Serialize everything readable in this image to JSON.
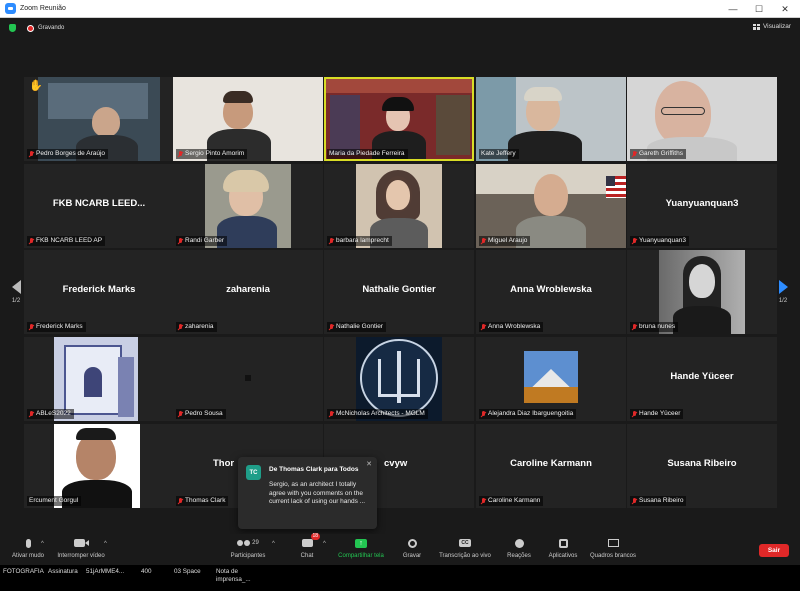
{
  "window": {
    "title": "Zoom Reunião"
  },
  "topbar": {
    "recording_label": "Gravando",
    "view_label": "Visualizar"
  },
  "pager": {
    "left_page": "1/2",
    "right_page": "1/2"
  },
  "tiles": [
    {
      "label": "Pedro Borges de Araújo",
      "raised_hand": true
    },
    {
      "label": "Sergio Pinto Amorim"
    },
    {
      "label": "Maria da Piedade Ferreira",
      "speaking": true
    },
    {
      "label": "Kate Jeffery"
    },
    {
      "label": "Gareth Griffiths"
    },
    {
      "label": "FKB NCARB LEED AP",
      "display_name": "FKB NCARB LEED..."
    },
    {
      "label": "Randi Garber"
    },
    {
      "label": "barbara lamprecht"
    },
    {
      "label": "Miguel Araujo"
    },
    {
      "label": "Yuanyuanquan3",
      "display_name": "Yuanyuanquan3"
    },
    {
      "label": "Frederick Marks",
      "display_name": "Frederick Marks"
    },
    {
      "label": "zaharenia",
      "display_name": "zaharenia"
    },
    {
      "label": "Nathalie Gontier",
      "display_name": "Nathalie Gontier"
    },
    {
      "label": "Anna Wroblewska",
      "display_name": "Anna Wroblewska"
    },
    {
      "label": "bruna nunes"
    },
    {
      "label": "ABLeS2022"
    },
    {
      "label": "Pedro Sousa"
    },
    {
      "label": "McNicholas Architects - MGLM"
    },
    {
      "label": "Alejandra Diaz Ibarguengoitia"
    },
    {
      "label": "Hande Yüceer",
      "display_name": "Hande Yüceer"
    },
    {
      "label": "Ercument Gorgul"
    },
    {
      "label": "Thomas Clark",
      "display_name": "Thor"
    },
    {
      "label": "",
      "display_name": "cvyw"
    },
    {
      "label": "Caroline Karmann",
      "display_name": "Caroline Karmann"
    },
    {
      "label": "Susana Ribeiro",
      "display_name": "Susana Ribeiro"
    }
  ],
  "chat_popup": {
    "avatar": "TC",
    "from": "De Thomas Clark para Todos",
    "message": "Sergio, as an architect I totally agree with you comments on the current lack of using our hands ..."
  },
  "toolbar": {
    "mute": "Ativar mudo",
    "stop_video": "Interromper vídeo",
    "participants": "Participantes",
    "participants_count": "29",
    "chat": "Chat",
    "chat_badge": "18",
    "share": "Compartilhar tela",
    "record": "Gravar",
    "transcript": "Transcrição ao vivo",
    "reactions": "Reações",
    "apps": "Aplicativos",
    "whiteboards": "Quadros brancos",
    "leave": "Sair"
  },
  "taskbar": [
    "FOTOGRAFIA",
    "Assinatura",
    "51jArMME4...",
    "400",
    "03 Space",
    "Nota de imprensa_..."
  ]
}
